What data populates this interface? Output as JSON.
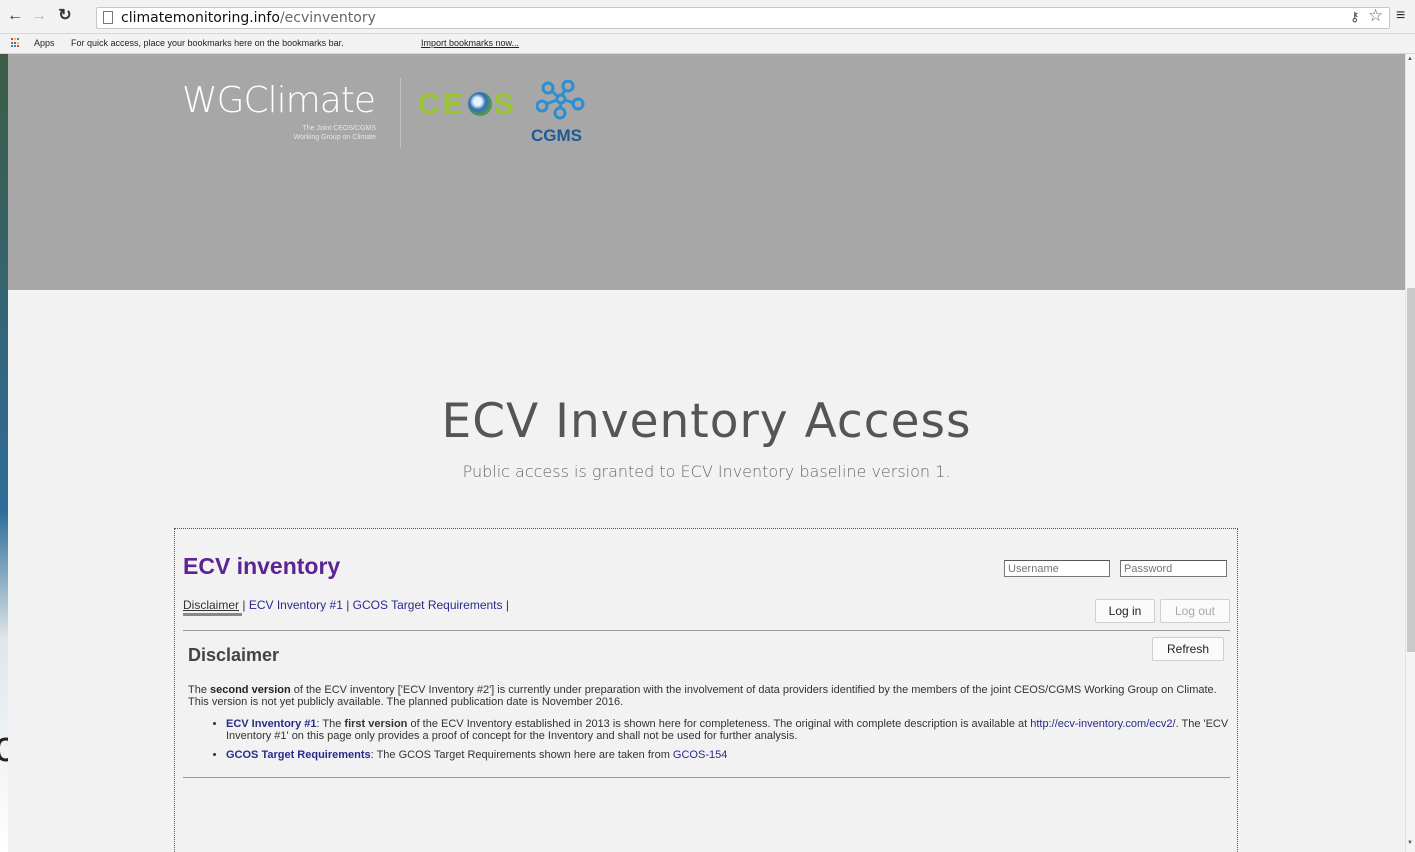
{
  "browser": {
    "url_host": "climatemonitoring.info",
    "url_path": "/ecvinventory",
    "bookmarks_apps": "Apps",
    "bookmarks_hint": "For quick access, place your bookmarks here on the bookmarks bar.",
    "bookmarks_import": "Import bookmarks now...",
    "icons": [
      "back-arrow-icon",
      "forward-arrow-icon",
      "reload-icon",
      "page-icon",
      "key-icon",
      "star-icon",
      "menu-icon",
      "apps-grid-icon"
    ]
  },
  "desktop_fragment": "c",
  "header": {
    "wg_title": "WGClimate",
    "wg_subtitle_line1": "The Joint CEOS/CGMS",
    "wg_subtitle_line2": "Working Group on Climate",
    "ceos_logo_text": "CE  S",
    "cgms_logo_text": "CGMS",
    "colors": {
      "band": "#a7a7a7",
      "ceos_green": "#9bc531",
      "cgms_blue": "#1f5a96"
    }
  },
  "hero": {
    "title": "ECV Inventory Access",
    "subtitle": "Public access is granted to ECV Inventory baseline version 1."
  },
  "app": {
    "title": "ECV inventory",
    "username_placeholder": "Username",
    "password_placeholder": "Password",
    "tabs": [
      {
        "label": "Disclaimer"
      },
      {
        "label": "ECV Inventory #1"
      },
      {
        "label": "GCOS Target Requirements"
      }
    ],
    "tab_separator": " | ",
    "login_label": "Log in",
    "logout_label": "Log out",
    "refresh_label": "Refresh",
    "section_title": "Disclaimer",
    "para": {
      "t1": "The ",
      "b1": "second version",
      "t2": " of the ECV inventory ['ECV Inventory #2'] is currently under preparation with the involvement of data providers identified by the members of the joint CEOS/CGMS Working Group on Climate. This version is not yet publicly available. The planned publication date is November 2016."
    },
    "bullet1": {
      "link": "ECV Inventory #1",
      "t1": ": The ",
      "b1": "first version",
      "t2": " of the ECV Inventory established in 2013 is shown here for completeness. The original with complete description is available at ",
      "url": "http://ecv-inventory.com/ecv2/",
      "t3": ". The 'ECV Inventory #1' on this page only provides a proof of concept for the Inventory and shall not be used for further analysis."
    },
    "bullet2": {
      "link": "GCOS Target Requirements",
      "t1": ": The GCOS Target Requirements shown here are taken from ",
      "ref": "GCOS-154"
    },
    "colors": {
      "title_purple": "#5c2393",
      "link_blue": "#2a2a8c"
    }
  }
}
